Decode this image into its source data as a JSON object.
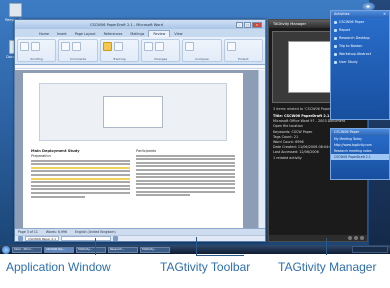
{
  "desktop": {
    "icons": [
      {
        "label": "Recycle Bin",
        "icon": "recycle-bin-icon"
      },
      {
        "label": "Document",
        "icon": "document-icon"
      }
    ]
  },
  "word": {
    "title": "CSCW06 PaperDraft 2.1 - Microsoft Word",
    "tabs": [
      "Home",
      "Insert",
      "Page Layout",
      "References",
      "Mailings",
      "Review",
      "View"
    ],
    "active_tab": "Review",
    "ribbon_groups": [
      "Proofing",
      "Comments",
      "Tracking",
      "Changes",
      "Compare",
      "Protect"
    ],
    "doc": {
      "col1_heading": "Main Deployment Study",
      "col1_sub": "Preparation",
      "col2_heading": "Participants"
    },
    "status": {
      "page": "Page 3 of 11",
      "words": "Words: 6,996",
      "language": "English (United Kingdom)"
    },
    "toolbar_project": "CSCW06 Paper 2.1"
  },
  "manager": {
    "title": "TAGtivity Manager",
    "count_text": "3 items related to 'CSCW06 Paper'",
    "details": {
      "title_line": "Title: CSCW06 PaperDraft 2.1",
      "app": "Microsoft Office Word 97 - 2003 Document",
      "open_with": "Open file location",
      "keywords": "Keywords: CSCW Paper",
      "tag_count": "Tags Count: 21",
      "word_count": "Word Count: 6996",
      "date_created": "Date Created: 11/06/2006 08:04:00",
      "last_accessed": "Last Accessed: 12/06/2006",
      "related": "1 related activity"
    }
  },
  "sidepanel": {
    "header": "Activities",
    "items": [
      "CSCW06 Paper",
      "Report",
      "Research Desktop",
      "Trip to Boston",
      "Workshop Abstract",
      "User Study"
    ]
  },
  "sidepanel2": {
    "header": "CSCW06 Paper",
    "items": [
      "My Meeting Today",
      "http://www.tagtivity.com",
      "Research meeting notes",
      "CSCW06 PaperDraft 2.1"
    ],
    "selected": 3
  },
  "taskbar": {
    "tasks": [
      "Inbox - Micro...",
      "CSCW06 Pap...",
      "TAGtivity...",
      "Research...",
      "TAGtivity..."
    ]
  },
  "callouts": {
    "app_window": "Application Window",
    "toolbar": "TAGtivity Toolbar",
    "manager": "TAGtivity Manager"
  }
}
